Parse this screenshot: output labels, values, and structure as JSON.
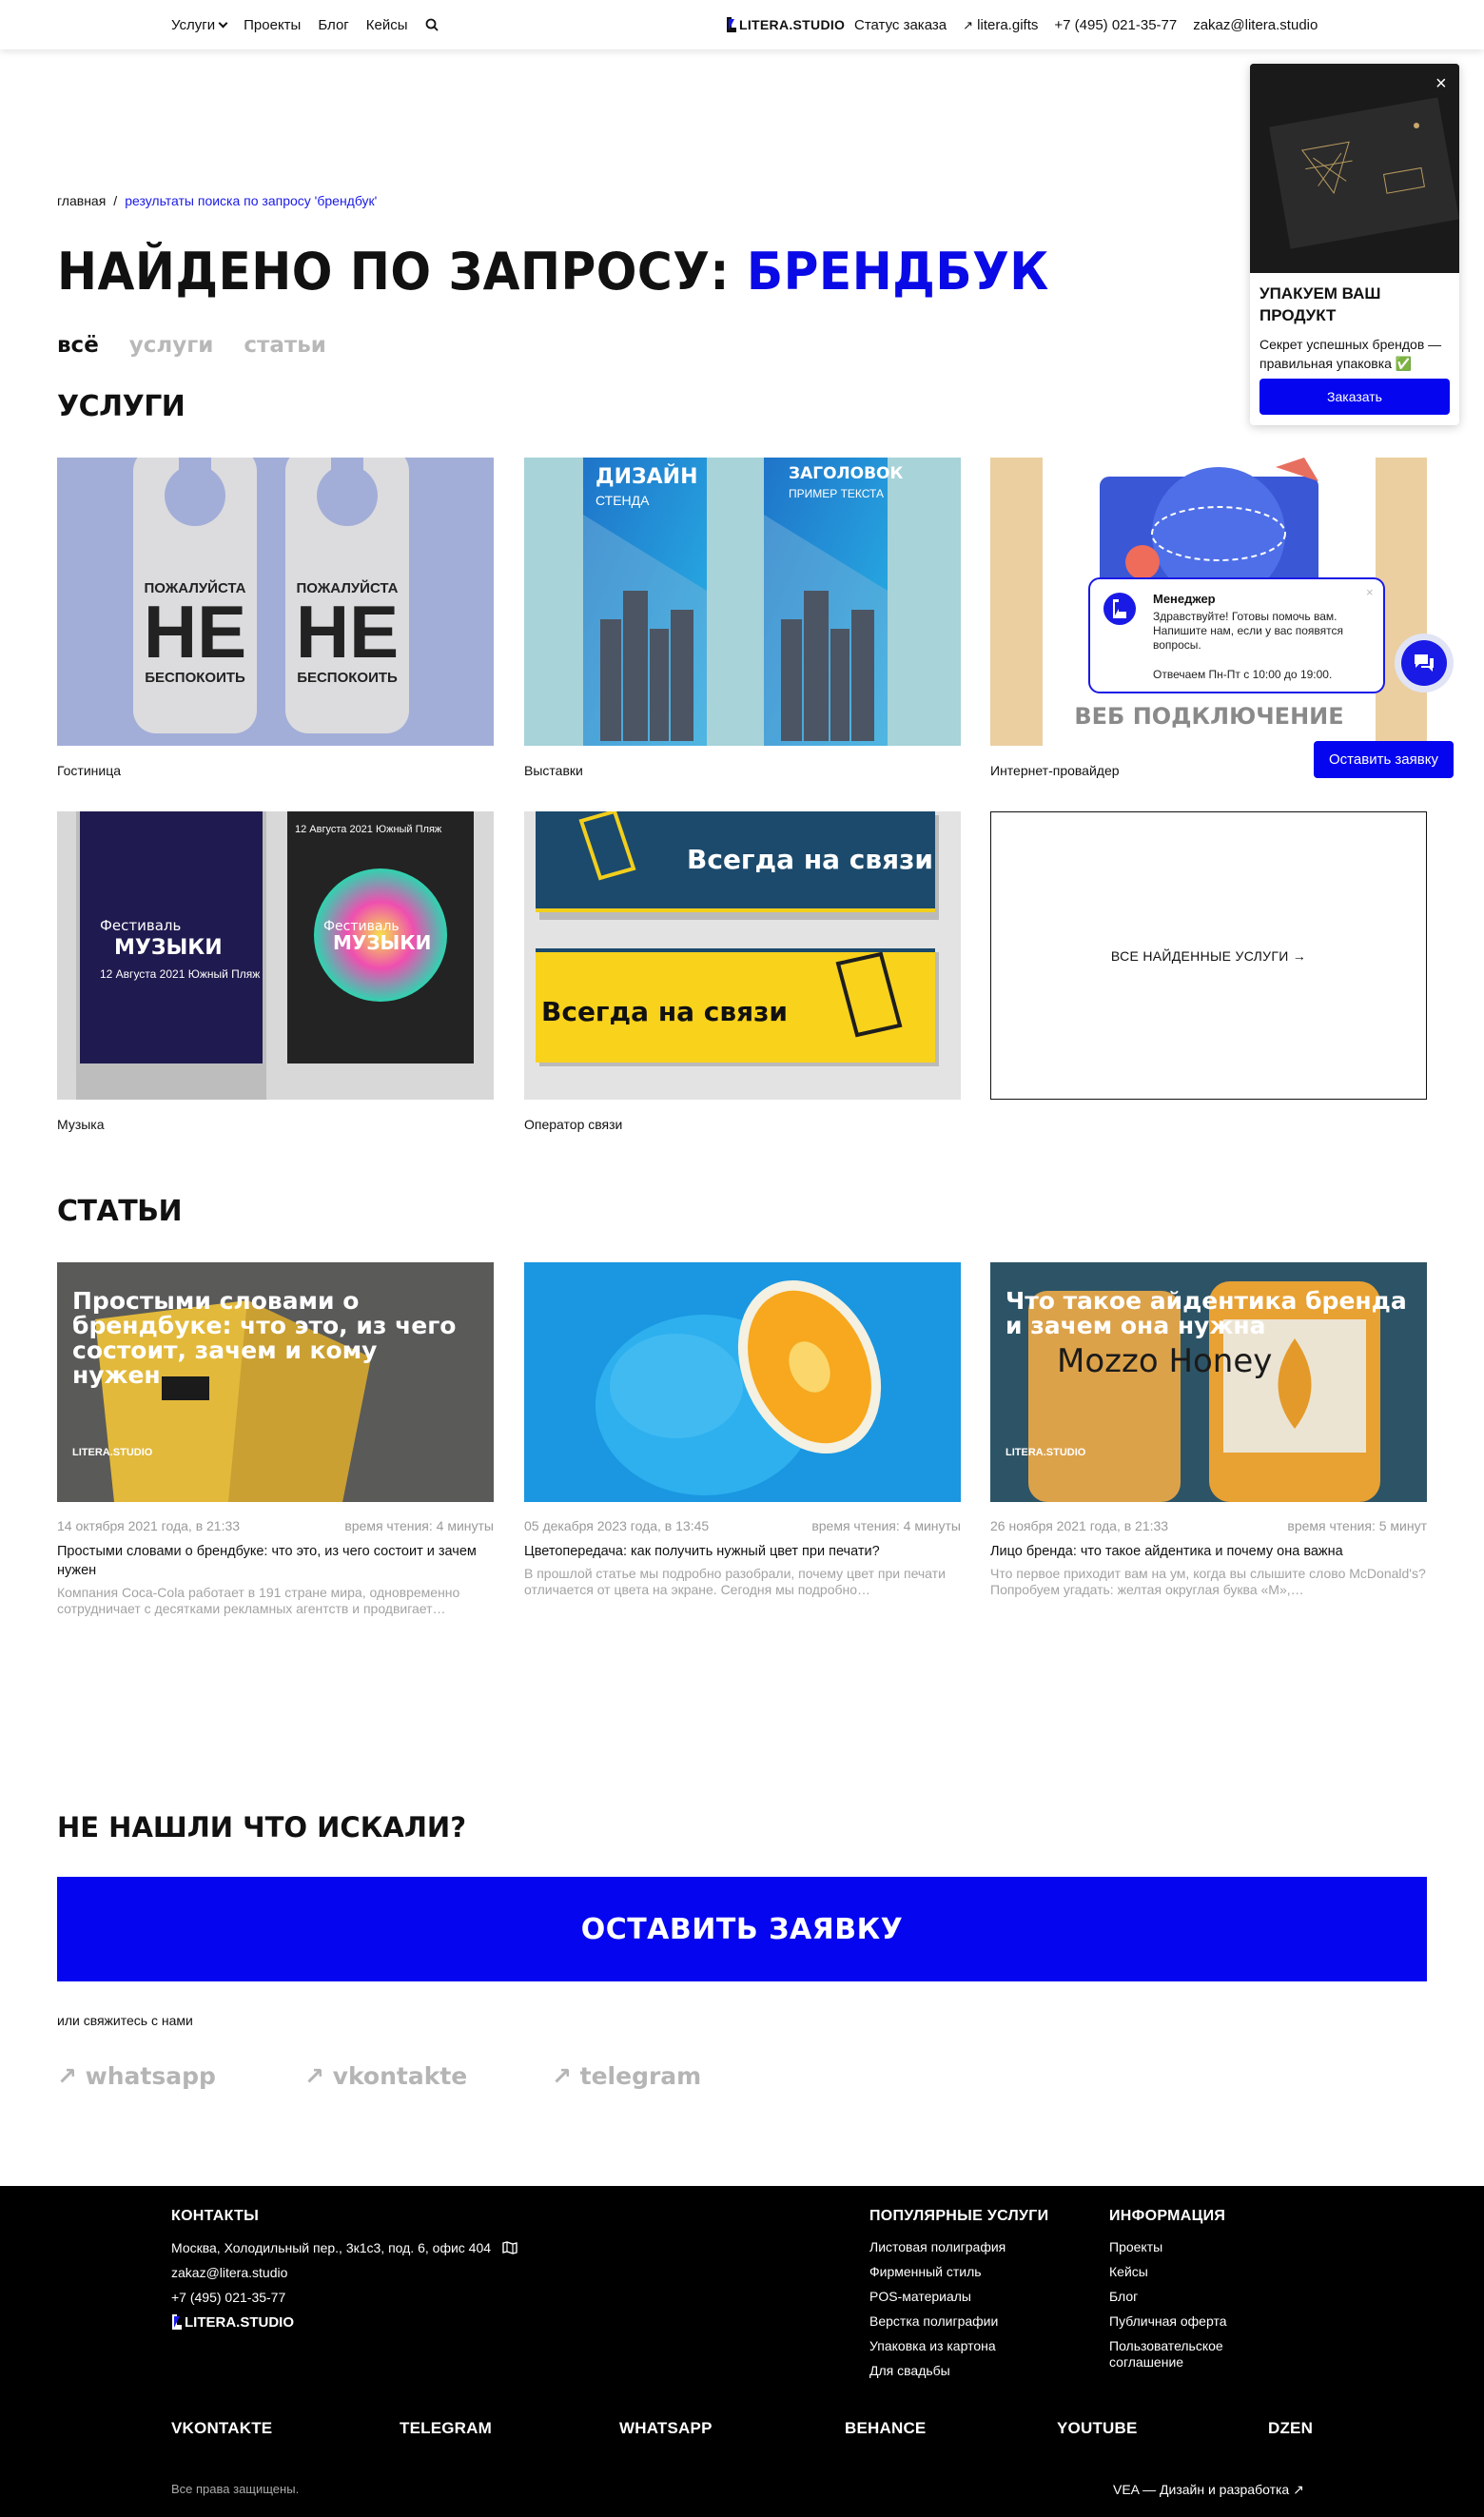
{
  "header": {
    "nav": [
      "Услуги",
      "Проекты",
      "Блог",
      "Кейсы"
    ],
    "logo": "LITERA.STUDIO",
    "order_status": "Статус заказа",
    "gifts_link": "litera.gifts",
    "phone": "+7 (495) 021-35-77",
    "email": "zakaz@litera.studio"
  },
  "breadcrumb": {
    "home": "главная",
    "separator": "/",
    "current": "результаты поиска по запросу 'брендбук'"
  },
  "title": {
    "prefix": "НАЙДЕНО ПО ЗАПРОСУ:",
    "query": "БРЕНДБУК"
  },
  "filters": [
    "всё",
    "услуги",
    "статьи"
  ],
  "services": {
    "heading": "УСЛУГИ",
    "items": [
      {
        "label": "Гостиница",
        "img_text_1": "ПОЖАЛУЙСТА",
        "img_text_2": "НЕ",
        "img_text_3": "БЕСПОКОИТЬ"
      },
      {
        "label": "Выставки",
        "img_text_1": "ДИЗАЙН",
        "img_text_2": "СТЕНДА",
        "img_text_3": "ЗАГОЛОВОК",
        "img_text_4": "ПРИМЕР ТЕКСТА"
      },
      {
        "label": "Интернет-провайдер",
        "img_text_1": "ВЕБ ПОДКЛЮЧЕНИЕ"
      },
      {
        "label": "Музыка",
        "img_text_1": "Фестиваль",
        "img_text_2": "МУЗЫКИ",
        "img_text_3": "12 Августа 2021 Южный Пляж"
      },
      {
        "label": "Оператор связи",
        "img_text_1": "Всегда на связи"
      }
    ],
    "all_link": "ВСЕ НАЙДЕННЫЕ УСЛУГИ →"
  },
  "articles": {
    "heading": "СТАТЬИ",
    "items": [
      {
        "date": "14 октября 2021 года, в 21:33",
        "read": "время чтения: 4 минуты",
        "title": "Простыми словами о брендбуке: что это, из чего состоит и зачем нужен",
        "desc": "Компания Coca-Cola работает в 191 стране мира, одновременно сотрудничает с десятками рекламных агентств и продвигает…",
        "img_text": "Простыми словами о брендбуке: что это, из чего состоит, зачем и кому нужен",
        "img_logo": "LITERA.STUDIO"
      },
      {
        "date": "05 декабря 2023 года, в 13:45",
        "read": "время чтения: 4 минуты",
        "title": "Цветопередача: как получить нужный цвет при печати?",
        "desc": "В прошлой статье мы подробно разобрали, почему цвет при печати отличается от цвета на экране. Сегодня мы подробно…"
      },
      {
        "date": "26 ноября 2021 года, в 21:33",
        "read": "время чтения: 5 минут",
        "title": "Лицо бренда: что такое айдентика и почему она важна",
        "desc": "Что первое приходит вам на ум, когда вы слышите слово McDonald's? Попробуем угадать: желтая округлая буква «М»,…",
        "img_text": "Что такое айдентика бренда и зачем она нужна",
        "img_logo": "LITERA.STUDIO",
        "jar_text": "Mozzo Honey"
      }
    ]
  },
  "cta": {
    "heading": "НЕ НАШЛИ ЧТО ИСКАЛИ?",
    "button": "ОСТАВИТЬ ЗАЯВКУ",
    "note": "или свяжитесь с нами",
    "messengers": [
      "↗ whatsapp",
      "↗ vkontakte",
      "↗ telegram"
    ]
  },
  "footer": {
    "contacts_h": "КОНТАКТЫ",
    "address": "Москва, Холодильный пер., 3к1с3, под. 6, офис 404",
    "email": "zakaz@litera.studio",
    "phone": "+7 (495) 021-35-77",
    "logo": "LITERA.STUDIO",
    "popular_h": "ПОПУЛЯРНЫЕ УСЛУГИ",
    "popular": [
      "Листовая полиграфия",
      "Фирменный стиль",
      "POS-материалы",
      "Верстка полиграфии",
      "Упаковка из картона",
      "Для свадьбы"
    ],
    "info_h": "ИНФОРМАЦИЯ",
    "info": [
      "Проекты",
      "Кейсы",
      "Блог",
      "Публичная оферта",
      "Пользовательское соглашение"
    ],
    "social": [
      "VKONTAKTE",
      "TELEGRAM",
      "WHATSAPP",
      "BEHANCE",
      "YOUTUBE",
      "DZEN"
    ],
    "rights": "Все права защищены.",
    "dev": "VEA — Дизайн и разработка ↗"
  },
  "promo": {
    "close": "×",
    "title": "УПАКУЕМ ВАШ ПРОДУКТ",
    "text": "Секрет успешных брендов — правильная упаковка ✅",
    "button": "Заказать"
  },
  "chat": {
    "name": "Менеджер",
    "message": "Здравствуйте! Готовы помочь вам. Напишите нам, если у вас появятся вопросы.",
    "hours": "Отвечаем Пн-Пт с 10:00 до 19:00.",
    "close": "×",
    "cta": "Оставить заявку"
  },
  "colors": {
    "accent": "#0505f0",
    "link": "#1a1ae6",
    "muted": "#9a9a9a",
    "footer_bg": "#000000"
  }
}
